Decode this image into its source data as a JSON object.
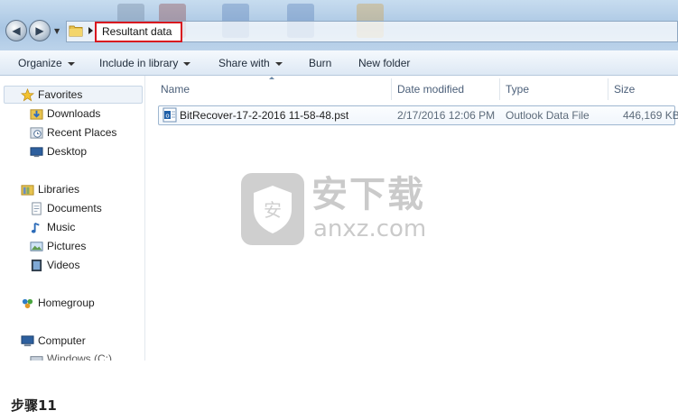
{
  "address_bar": {
    "breadcrumb": "Resultant data",
    "back_icon": "back-arrow-icon",
    "forward_icon": "forward-arrow-icon"
  },
  "toolbar": {
    "organize": "Organize",
    "include_in_library": "Include in library",
    "share_with": "Share with",
    "burn": "Burn",
    "new_folder": "New folder"
  },
  "nav_pane": {
    "favorites": {
      "label": "Favorites",
      "icon": "star-icon",
      "items": [
        {
          "label": "Downloads",
          "icon": "downloads-folder-icon"
        },
        {
          "label": "Recent Places",
          "icon": "recent-places-icon"
        },
        {
          "label": "Desktop",
          "icon": "desktop-icon"
        }
      ]
    },
    "libraries": {
      "label": "Libraries",
      "icon": "libraries-icon",
      "items": [
        {
          "label": "Documents",
          "icon": "documents-icon"
        },
        {
          "label": "Music",
          "icon": "music-icon"
        },
        {
          "label": "Pictures",
          "icon": "pictures-icon"
        },
        {
          "label": "Videos",
          "icon": "videos-icon"
        }
      ]
    },
    "homegroup": {
      "label": "Homegroup",
      "icon": "homegroup-icon"
    },
    "computer": {
      "label": "Computer",
      "icon": "computer-icon",
      "items": [
        {
          "label": "Windows (C:)",
          "icon": "drive-icon"
        }
      ]
    }
  },
  "file_list": {
    "columns": [
      "Name",
      "Date modified",
      "Type",
      "Size"
    ],
    "rows": [
      {
        "name": "BitRecover-17-2-2016 11-58-48.pst",
        "date_modified": "2/17/2016 12:06 PM",
        "type": "Outlook Data File",
        "size": "446,169 KB",
        "icon": "outlook-data-file-icon"
      }
    ]
  },
  "watermark": {
    "chinese_text": "安下载",
    "domain_text": "anxz.com",
    "icon": "shield-logo-icon"
  },
  "caption": "步骤11",
  "colors": {
    "highlight_border": "#d8161f",
    "title_gradient": "#a9c6e3",
    "header_text": "#4c607a"
  }
}
